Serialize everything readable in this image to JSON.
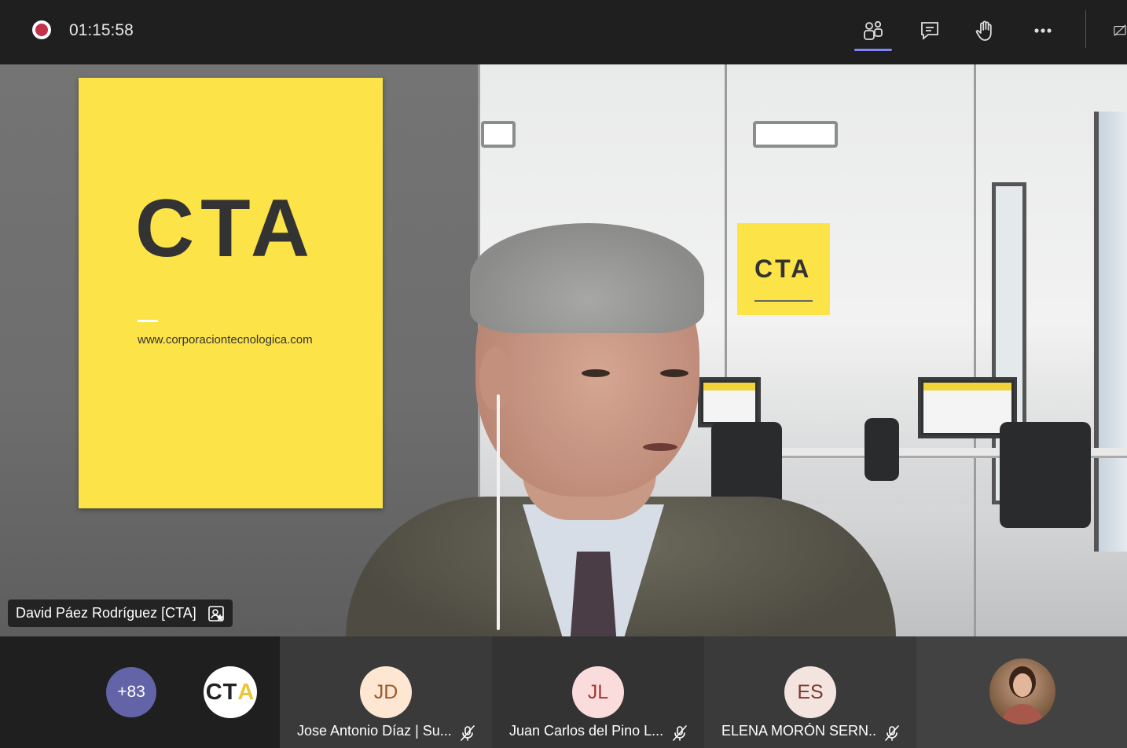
{
  "topbar": {
    "timer": "01:15:58",
    "recording_color": "#c4314b",
    "buttons": [
      {
        "name": "people",
        "icon": "people-icon",
        "active": true
      },
      {
        "name": "chat",
        "icon": "chat-icon"
      },
      {
        "name": "raise-hand",
        "icon": "raise-hand-icon"
      },
      {
        "name": "more",
        "icon": "more-actions-icon"
      },
      {
        "name": "share",
        "icon": "share-tray-icon"
      }
    ],
    "accent": "#7f85f5"
  },
  "stage": {
    "poster": {
      "logo": "CTA",
      "url": "www.corporaciontecnologica.com"
    },
    "wall_sign": {
      "logo": "CTA"
    },
    "speaker_name": "David Páez Rodríguez [CTA]",
    "speaker_icon": "organizer-badge-icon"
  },
  "gallery": {
    "overflow_count": "+83",
    "org_avatar": {
      "text_a": "CT",
      "text_b": "A"
    },
    "participants": [
      {
        "initials": "JD",
        "name": "Jose Antonio Díaz | Su...",
        "muted": true,
        "avatar_bg": "#fde7d2",
        "avatar_fg": "#9a5a2a"
      },
      {
        "initials": "JL",
        "name": "Juan Carlos del Pino L...",
        "muted": true,
        "avatar_bg": "#fbdcdc",
        "avatar_fg": "#a33a3a"
      },
      {
        "initials": "ES",
        "name": "ELENA MORÓN SERN...",
        "muted": true,
        "avatar_bg": "#f4e4df",
        "avatar_fg": "#7b3a2c"
      }
    ]
  }
}
